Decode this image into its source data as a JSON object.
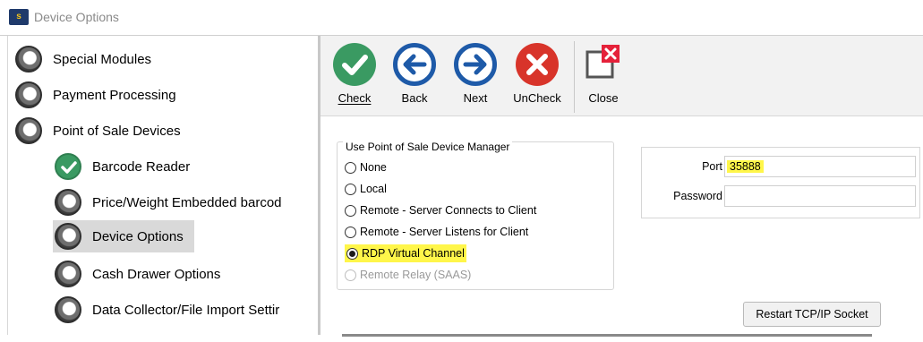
{
  "window": {
    "title": "Device Options",
    "app_icon_text": "s"
  },
  "sidebar": {
    "items": [
      {
        "label": "Special Modules",
        "state": "unchecked",
        "selected": false
      },
      {
        "label": "Payment Processing",
        "state": "unchecked",
        "selected": false
      },
      {
        "label": "Point of Sale Devices",
        "state": "unchecked",
        "selected": false
      },
      {
        "label": "Barcode Reader",
        "state": "checked",
        "selected": false
      },
      {
        "label": "Price/Weight Embedded barcod",
        "state": "unchecked",
        "selected": false
      },
      {
        "label": "Device Options",
        "state": "unchecked",
        "selected": true
      },
      {
        "label": "Cash Drawer Options",
        "state": "unchecked",
        "selected": false
      },
      {
        "label": "Data Collector/File Import Settir",
        "state": "unchecked",
        "selected": false
      }
    ]
  },
  "toolbar": {
    "check_label": "Check",
    "back_label": "Back",
    "next_label": "Next",
    "uncheck_label": "UnCheck",
    "close_label": "Close",
    "colors": {
      "check": "#3a9a62",
      "nav": "#1e5aa8",
      "uncheck": "#d8342a",
      "close_badge": "#e5213a"
    }
  },
  "device_manager": {
    "legend": "Use Point of Sale Device Manager",
    "options": [
      {
        "label": "None",
        "selected": false,
        "enabled": true,
        "highlight": false
      },
      {
        "label": "Local",
        "selected": false,
        "enabled": true,
        "highlight": false
      },
      {
        "label": "Remote -  Server Connects to Client",
        "selected": false,
        "enabled": true,
        "highlight": false
      },
      {
        "label": "Remote -  Server Listens for Client",
        "selected": false,
        "enabled": true,
        "highlight": false
      },
      {
        "label": "RDP Virtual Channel",
        "selected": true,
        "enabled": true,
        "highlight": true
      },
      {
        "label": "Remote Relay (SAAS)",
        "selected": false,
        "enabled": false,
        "highlight": false
      }
    ]
  },
  "connection": {
    "port_label": "Port",
    "port_value": "35888",
    "password_label": "Password",
    "password_value": ""
  },
  "restart_button": {
    "label": "Restart TCP/IP Socket"
  },
  "highlight_color": "#fff64a"
}
